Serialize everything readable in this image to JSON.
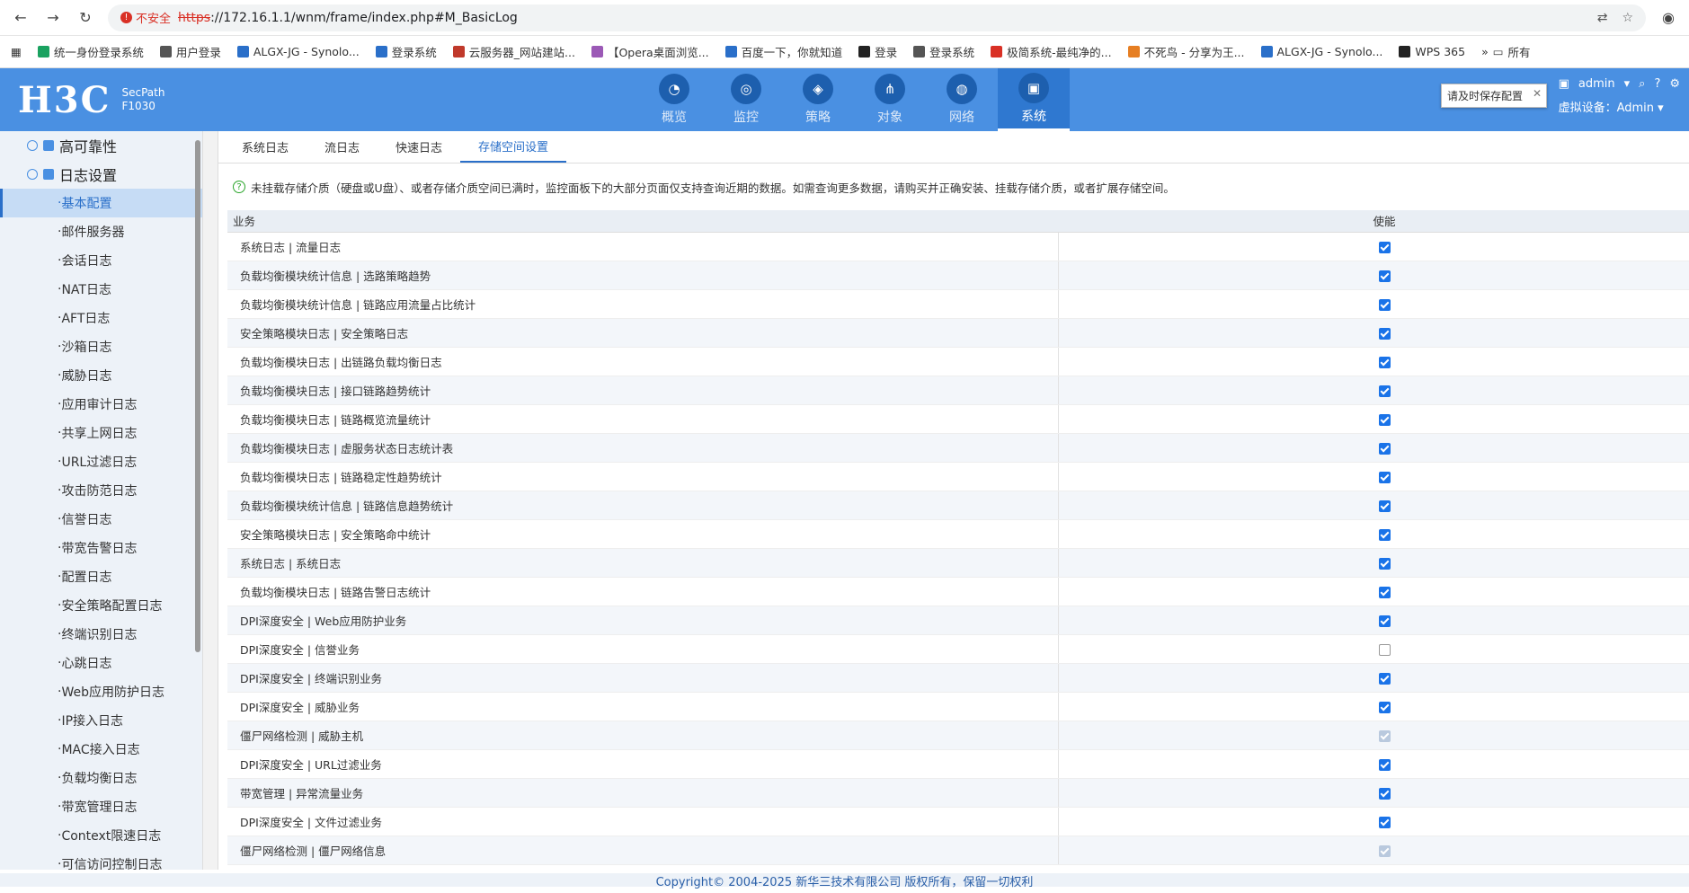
{
  "browser": {
    "insecure_label": "不安全",
    "url_protocol": "https",
    "url_rest": "://172.16.1.1/wnm/frame/index.php#M_BasicLog",
    "bookmarks": [
      "统一身份登录系统",
      "用户登录",
      "ALGX-JG - Synolo...",
      "登录系统",
      "云服务器_网站建站...",
      "【Opera桌面浏览...",
      "百度一下，你就知道",
      "登录",
      "登录系统",
      "极简系统-最纯净的...",
      "不死鸟 - 分享为王...",
      "ALGX-JG - Synolo...",
      "WPS 365"
    ],
    "bookmarks_more": "所有"
  },
  "header": {
    "logo": "H3C",
    "model_line1": "SecPath",
    "model_line2": "F1030",
    "nav": [
      "概览",
      "监控",
      "策略",
      "对象",
      "网络",
      "系统"
    ],
    "user": "admin",
    "virtual_device": "虚拟设备：Admin",
    "save_tip": "请及时保存配置"
  },
  "sidebar": {
    "groups": [
      "高可靠性",
      "日志设置"
    ],
    "items": [
      "基本配置",
      "邮件服务器",
      "会话日志",
      "NAT日志",
      "AFT日志",
      "沙箱日志",
      "威胁日志",
      "应用审计日志",
      "共享上网日志",
      "URL过滤日志",
      "攻击防范日志",
      "信誉日志",
      "带宽告警日志",
      "配置日志",
      "安全策略配置日志",
      "终端识别日志",
      "心跳日志",
      "Web应用防护日志",
      "IP接入日志",
      "MAC接入日志",
      "负载均衡日志",
      "带宽管理日志",
      "Context限速日志",
      "可信访问控制日志"
    ]
  },
  "tabs": [
    "系统日志",
    "流日志",
    "快速日志",
    "存储空间设置"
  ],
  "notice": "未挂载存储介质（硬盘或U盘）、或者存储介质空间已满时，监控面板下的大部分页面仅支持查询近期的数据。如需查询更多数据，请购买并正确安装、挂载存储介质，或者扩展存储空间。",
  "table": {
    "col_business": "业务",
    "col_enable": "使能",
    "rows": [
      {
        "name": "系统日志 | 流量日志",
        "state": "on"
      },
      {
        "name": "负载均衡模块统计信息 | 选路策略趋势",
        "state": "on"
      },
      {
        "name": "负载均衡模块统计信息 | 链路应用流量占比统计",
        "state": "on"
      },
      {
        "name": "安全策略模块日志 | 安全策略日志",
        "state": "on"
      },
      {
        "name": "负载均衡模块日志 | 出链路负载均衡日志",
        "state": "on"
      },
      {
        "name": "负载均衡模块日志 | 接口链路趋势统计",
        "state": "on"
      },
      {
        "name": "负载均衡模块日志 | 链路概览流量统计",
        "state": "on"
      },
      {
        "name": "负载均衡模块日志 | 虚服务状态日志统计表",
        "state": "on"
      },
      {
        "name": "负载均衡模块日志 | 链路稳定性趋势统计",
        "state": "on"
      },
      {
        "name": "负载均衡模块统计信息 | 链路信息趋势统计",
        "state": "on"
      },
      {
        "name": "安全策略模块日志 | 安全策略命中统计",
        "state": "on"
      },
      {
        "name": "系统日志 | 系统日志",
        "state": "on"
      },
      {
        "name": "负载均衡模块日志 | 链路告警日志统计",
        "state": "on"
      },
      {
        "name": "DPI深度安全 | Web应用防护业务",
        "state": "on"
      },
      {
        "name": "DPI深度安全 | 信誉业务",
        "state": "off"
      },
      {
        "name": "DPI深度安全 | 终端识别业务",
        "state": "on"
      },
      {
        "name": "DPI深度安全 | 威胁业务",
        "state": "on"
      },
      {
        "name": "僵尸网络检测 | 威胁主机",
        "state": "dis"
      },
      {
        "name": "DPI深度安全 | URL过滤业务",
        "state": "on"
      },
      {
        "name": "带宽管理 | 异常流量业务",
        "state": "on"
      },
      {
        "name": "DPI深度安全 | 文件过滤业务",
        "state": "on"
      },
      {
        "name": "僵尸网络检测 | 僵尸网络信息",
        "state": "dis"
      }
    ]
  },
  "footer": "Copyright© 2004-2025 新华三技术有限公司 版权所有，保留一切权利"
}
